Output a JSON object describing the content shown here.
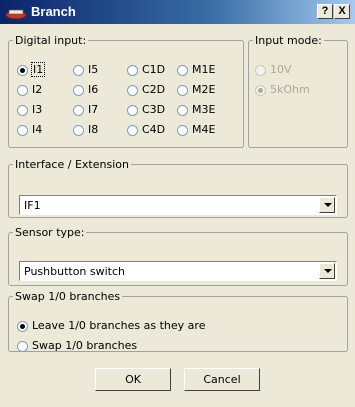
{
  "window": {
    "title": "Branch",
    "help_label": "?",
    "close_label": "X"
  },
  "digital_input": {
    "legend": "Digital input:",
    "options": [
      "I1",
      "I5",
      "C1D",
      "M1E",
      "I2",
      "I6",
      "C2D",
      "M2E",
      "I3",
      "I7",
      "C3D",
      "M3E",
      "I4",
      "I8",
      "C4D",
      "M4E"
    ],
    "selected": "I1"
  },
  "input_mode": {
    "legend": "Input mode:",
    "options": [
      "10V",
      "5kOhm"
    ],
    "selected": "5kOhm",
    "enabled": false
  },
  "interface": {
    "legend": "Interface / Extension",
    "value": "IF1"
  },
  "sensor": {
    "legend": "Sensor type:",
    "value": "Pushbutton switch"
  },
  "swap": {
    "legend": "Swap 1/0 branches",
    "options": [
      "Leave 1/0 branches as they are",
      "Swap 1/0 branches"
    ],
    "selected": "Leave 1/0 branches as they are"
  },
  "buttons": {
    "ok": "OK",
    "cancel": "Cancel"
  }
}
